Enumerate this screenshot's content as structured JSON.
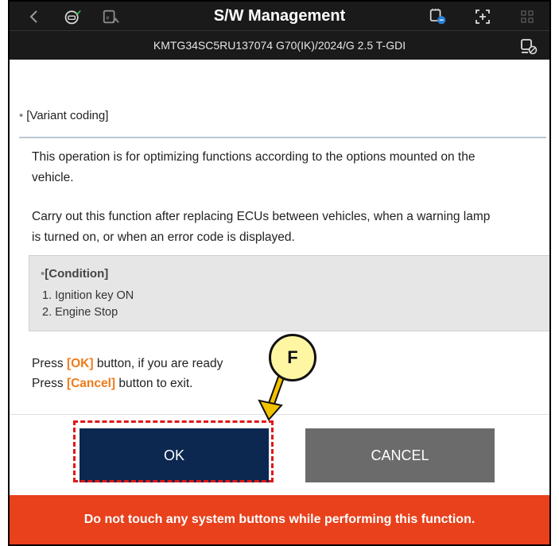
{
  "header": {
    "title": "S/W Management",
    "vehicle_info": "KMTG34SC5RU137074  G70(IK)/2024/G 2.5 T-GDI",
    "icons": [
      "back-arrow-icon",
      "wifi-car-icon",
      "ecu-upload-icon",
      "vci-connect-icon",
      "screen-capture-icon",
      "grid-menu-icon",
      "car-settings-icon"
    ]
  },
  "section": {
    "title": "[Variant coding]"
  },
  "body": {
    "para1_line1": "This operation is for optimizing functions according to the options mounted on the",
    "para1_line2": "vehicle.",
    "para2_line1": "Carry out this function after replacing ECUs between vehicles, when a warning lamp",
    "para2_line2": "is turned on, or when an error code is displayed."
  },
  "condition": {
    "title": "[Condition]",
    "items": [
      "1. Ignition key ON",
      "2. Engine Stop"
    ]
  },
  "instructions": {
    "line1_prefix": "Press ",
    "line1_key": "[OK]",
    "line1_suffix": " button, if you are ready",
    "line2_prefix": "Press ",
    "line2_key": "[Cancel]",
    "line2_suffix": " button to exit."
  },
  "buttons": {
    "ok": "OK",
    "cancel": "CANCEL"
  },
  "warning": "Do not touch any system buttons while performing this function.",
  "callout": {
    "label": "F"
  },
  "colors": {
    "header_bg": "#1a1a1a",
    "ok_bg": "#0c2750",
    "cancel_bg": "#6b6b6b",
    "warning_bg": "#e8411c",
    "highlight": "#f07a18",
    "callout_fill": "#fff6a4"
  }
}
